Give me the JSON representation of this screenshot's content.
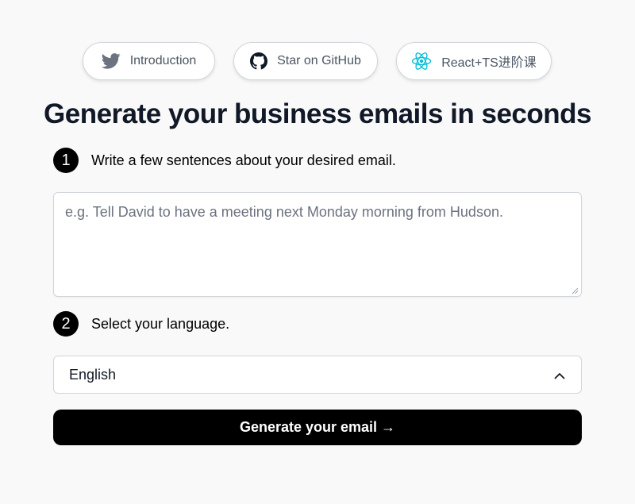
{
  "nav": {
    "introduction_label": "Introduction",
    "github_label": "Star on GitHub",
    "course_label": "React+TS进阶课"
  },
  "page": {
    "title": "Generate your business emails in seconds"
  },
  "step1": {
    "number": "1",
    "label": "Write a few sentences about your desired email."
  },
  "prompt": {
    "value": "",
    "placeholder": "e.g. Tell David to have a meeting next Monday morning from Hudson."
  },
  "step2": {
    "number": "2",
    "label": "Select your language."
  },
  "language": {
    "selected": "English"
  },
  "action": {
    "generate_label": "Generate your email →"
  },
  "colors": {
    "twitter_icon": "#6b7280",
    "react_icon": "#00bcd4",
    "button_bg": "#000000"
  },
  "icons": [
    "twitter-icon",
    "github-icon",
    "react-icon",
    "chevron-up-icon"
  ]
}
